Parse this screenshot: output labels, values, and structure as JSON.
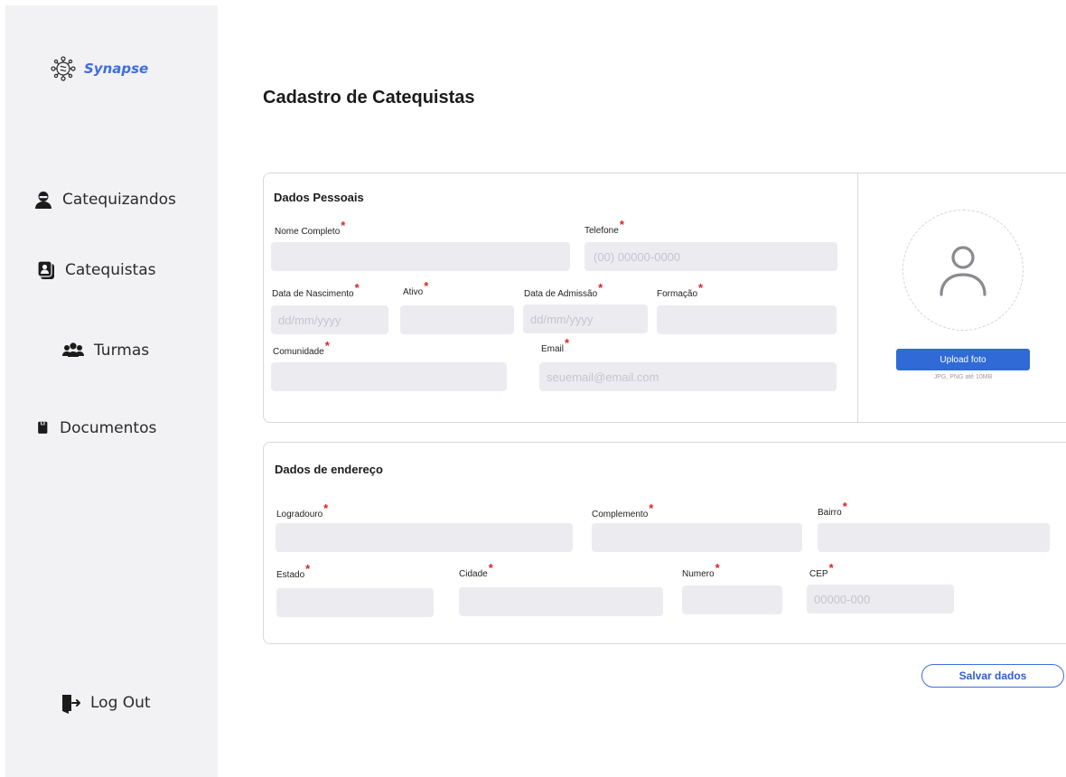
{
  "sidebar": {
    "logo_text": "Synapse",
    "items": [
      {
        "label": "Catequizandos",
        "icon": "user-icon"
      },
      {
        "label": "Catequistas",
        "icon": "contact-book-icon"
      },
      {
        "label": "Turmas",
        "icon": "group-icon"
      },
      {
        "label": "Documentos",
        "icon": "document-icon"
      }
    ],
    "logout": {
      "label": "Log Out",
      "icon": "logout-icon"
    }
  },
  "page_title": "Cadastro de Catequistas",
  "personal": {
    "title": "Dados Pessoais",
    "fields": {
      "nome": {
        "label": "Nome Completo",
        "placeholder": ""
      },
      "telefone": {
        "label": "Telefone",
        "placeholder": "(00) 00000-0000"
      },
      "nascimento": {
        "label": "Data de Nascimento",
        "placeholder": "dd/mm/yyyy"
      },
      "ativo": {
        "label": "Ativo",
        "placeholder": ""
      },
      "admissao": {
        "label": "Data de Admissão",
        "placeholder": "dd/mm/yyyy"
      },
      "formacao": {
        "label": "Formação",
        "placeholder": ""
      },
      "comunidade": {
        "label": "Comunidade",
        "placeholder": ""
      },
      "email": {
        "label": "Email",
        "placeholder": "seuemail@email.com"
      }
    },
    "photo": {
      "upload_label": "Upload foto",
      "hint": "JPG, PNG até 10MB"
    }
  },
  "address": {
    "title": "Dados de endereço",
    "fields": {
      "logradouro": {
        "label": "Logradouro",
        "placeholder": ""
      },
      "complemento": {
        "label": "Complemento",
        "placeholder": ""
      },
      "bairro": {
        "label": "Bairro",
        "placeholder": ""
      },
      "estado": {
        "label": "Estado",
        "placeholder": ""
      },
      "cidade": {
        "label": "Cidade",
        "placeholder": ""
      },
      "numero": {
        "label": "Numero",
        "placeholder": ""
      },
      "cep": {
        "label": "CEP",
        "placeholder": "00000-000"
      }
    }
  },
  "required_mark": "*",
  "save_label": "Salvar dados",
  "colors": {
    "accent": "#3d6ee0",
    "button": "#2f6ad6",
    "required": "#e02020",
    "sidebar_bg": "#f2f2f4",
    "input_bg": "#ececf0"
  }
}
